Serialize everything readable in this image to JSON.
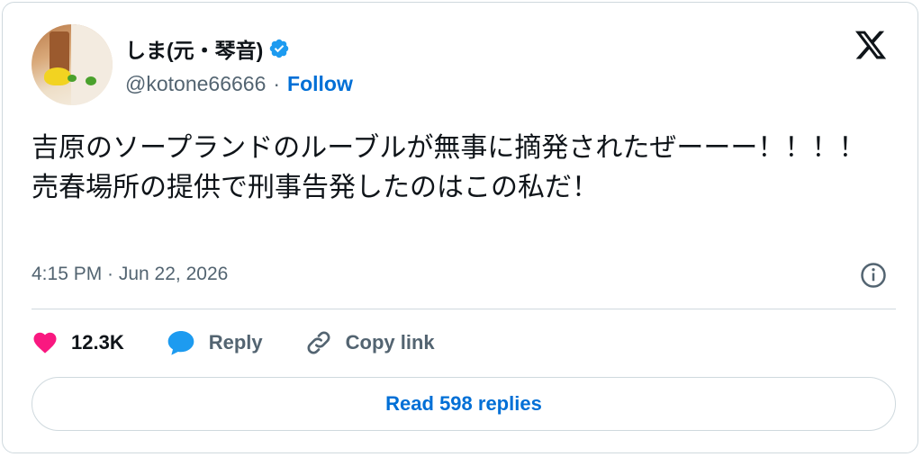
{
  "author": {
    "display_name": "しま(元・琴音)",
    "handle": "@kotone66666",
    "separator": "·",
    "follow_label": "Follow",
    "verified_icon": "verified-badge-icon"
  },
  "tweet": {
    "text": "吉原のソープランドのルーブルが無事に摘発されたぜーーー！！！！\n売春場所の提供で刑事告発したのはこの私だ！",
    "timestamp": "4:15 PM · Jun 22, 2026"
  },
  "actions": {
    "likes_count": "12.3K",
    "reply_label": "Reply",
    "copy_link_label": "Copy link"
  },
  "replies_button_label": "Read 598 replies",
  "colors": {
    "accent": "#006fd6",
    "like": "#f91880",
    "muted": "#536471",
    "border": "#cfd9de"
  }
}
